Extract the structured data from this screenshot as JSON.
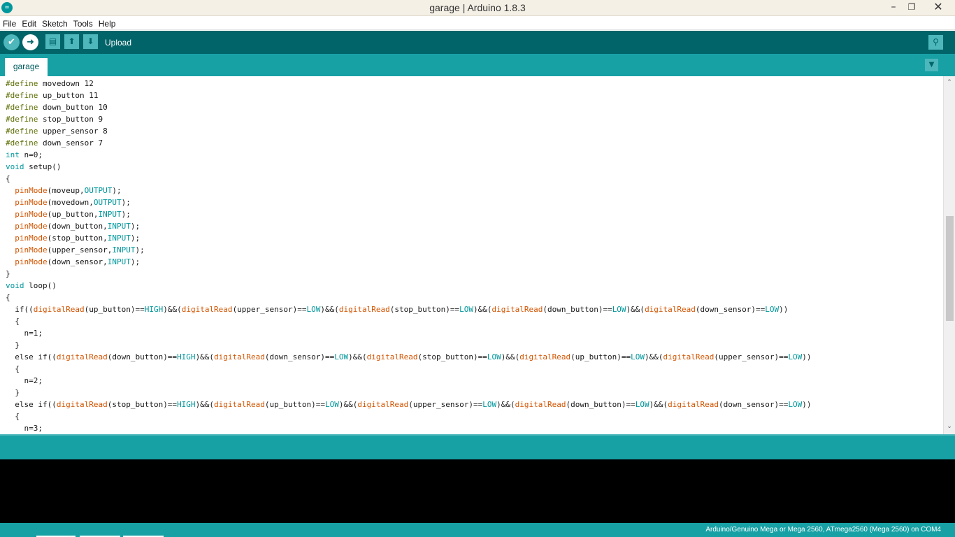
{
  "window": {
    "title": "garage | Arduino 1.8.3",
    "icon": "arduino-logo",
    "controls": [
      "minimize",
      "maximize",
      "close"
    ]
  },
  "menu": [
    "File",
    "Edit",
    "Sketch",
    "Tools",
    "Help"
  ],
  "toolbar": {
    "hover_label": "Upload",
    "buttons": [
      "verify-icon",
      "upload-icon",
      "new-icon",
      "open-icon",
      "save-icon",
      "serial-monitor-icon"
    ]
  },
  "tabs": {
    "active": "garage"
  },
  "editor": {
    "lines": [
      "#define movedown 12",
      "#define up_button 11",
      "#define down_button 10",
      "#define stop_button 9",
      "#define upper_sensor 8",
      "#define down_sensor 7",
      "int n=0;",
      "void setup()",
      "{",
      "  pinMode(moveup,OUTPUT);",
      "  pinMode(movedown,OUTPUT);",
      "  pinMode(up_button,INPUT);",
      "  pinMode(down_button,INPUT);",
      "  pinMode(stop_button,INPUT);",
      "  pinMode(upper_sensor,INPUT);",
      "  pinMode(down_sensor,INPUT);",
      "}",
      "void loop()",
      "{",
      "  if((digitalRead(up_button)==HIGH)&&(digitalRead(upper_sensor)==LOW)&&(digitalRead(stop_button)==LOW)&&(digitalRead(down_button)==LOW)&&(digitalRead(down_sensor)==LOW))",
      "  {",
      "    n=1;",
      "  }",
      "  else if((digitalRead(down_button)==HIGH)&&(digitalRead(down_sensor)==LOW)&&(digitalRead(stop_button)==LOW)&&(digitalRead(up_button)==LOW)&&(digitalRead(upper_sensor)==LOW))",
      "  {",
      "    n=2;",
      "  }",
      "  else if((digitalRead(stop_button)==HIGH)&&(digitalRead(up_button)==LOW)&&(digitalRead(upper_sensor)==LOW)&&(digitalRead(down_button)==LOW)&&(digitalRead(down_sensor)==LOW))",
      "  {",
      "    n=3;"
    ]
  },
  "status": {
    "message": "",
    "board": "Arduino/Genuino Mega or Mega 2560, ATmega2560 (Mega 2560) on COM4"
  },
  "colors": {
    "toolbar": "#006468",
    "tabbar": "#17a1a5",
    "keyword": "#00979c",
    "function": "#d35400",
    "preprocessor": "#5e6d03"
  }
}
